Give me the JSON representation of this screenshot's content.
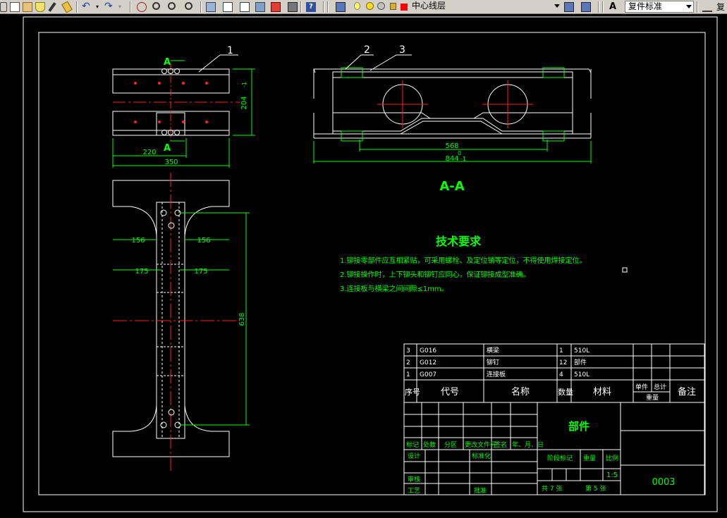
{
  "toolbar": {
    "layer_name": "中心线层",
    "dim_style": "复件标准",
    "right_edge_char": "复"
  },
  "drawing": {
    "callouts": [
      "1",
      "2",
      "3"
    ],
    "section_marks": [
      "A",
      "A"
    ],
    "dims": {
      "top_height": "204",
      "top_height_tol": "-1",
      "top_220": "220",
      "top_350": "350",
      "sec_568": "568",
      "sec_844": "844",
      "sec_844_tol": "-1",
      "sec_tol_top": "0",
      "plan_156_l": "156",
      "plan_156_r": "156",
      "plan_175_l": "175",
      "plan_175_r": "175",
      "plan_638": "638"
    },
    "section_title": "A-A",
    "tech_title": "技术要求",
    "tech_notes": [
      "1.铆接零部件应互相紧贴，可采用螺栓、及定位销等定位，不得使用焊接定位。",
      "2.铆接操作时，上下铆头和铆钉应同心，保证铆接成型准确。",
      "3.连接板与横梁之间间隙≤1mm。"
    ]
  },
  "bom": {
    "rows": [
      {
        "no": "3",
        "code": "G016",
        "name": "横梁",
        "qty": "1",
        "material": "510L"
      },
      {
        "no": "2",
        "code": "G012",
        "name": "铆钉",
        "qty": "12",
        "material": "部件"
      },
      {
        "no": "1",
        "code": "G007",
        "name": "连接板",
        "qty": "4",
        "material": "510L"
      }
    ],
    "headers": {
      "no": "序号",
      "code": "代号",
      "name": "名称",
      "qty": "数量",
      "material": "材料",
      "unit": "单件",
      "total": "总计",
      "weight": "重量",
      "remark": "备注"
    }
  },
  "title_block": {
    "part_name": "部件",
    "drawing_no": "0003",
    "scale": "1:5",
    "labels": {
      "mark": "标记",
      "count": "处数",
      "zone": "分区",
      "doc_no": "更改文件号",
      "sign": "签名",
      "date": "年、月、日",
      "design": "设计",
      "standardize": "标准化",
      "stage": "阶段标记",
      "mass": "重量",
      "ratio": "比例",
      "check": "审核",
      "process": "工艺",
      "approve": "批准",
      "total_sheets": "共 7 张",
      "sheet_no": "第 5 张"
    }
  }
}
